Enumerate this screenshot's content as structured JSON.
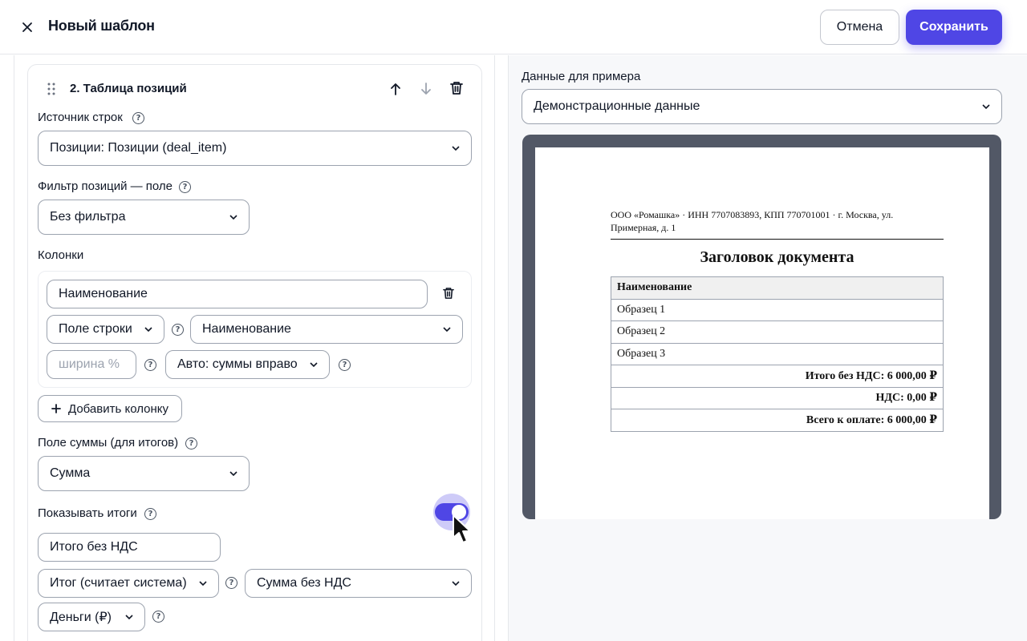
{
  "header": {
    "title": "Новый шаблон",
    "cancel_label": "Отмена",
    "save_label": "Сохранить"
  },
  "section": {
    "title": "2. Таблица позиций",
    "row_source": {
      "label": "Источник строк",
      "value": "Позиции: Позиции (deal_item)"
    },
    "filter": {
      "label": "Фильтр позиций — поле",
      "value": "Без фильтра"
    },
    "columns": {
      "label": "Колонки",
      "items": [
        {
          "name": "Наименование",
          "type": "Поле строки",
          "field": "Наименование",
          "width_placeholder": "ширина %",
          "align": "Авто: суммы вправо"
        }
      ],
      "add_label": "Добавить колонку"
    },
    "sum_field": {
      "label": "Поле суммы (для итогов)",
      "value": "Сумма"
    },
    "show_totals": {
      "label": "Показывать итоги",
      "enabled": true
    },
    "total_row": {
      "name": "Итого без НДС",
      "kind": "Итог (считает система)",
      "source": "Сумма без НДС",
      "format": "Деньги (₽)"
    }
  },
  "preview": {
    "data_label": "Данные для примера",
    "data_value": "Демонстрационные данные",
    "document": {
      "company_line": "ООО «Ромашка» · ИНН 7707083893, КПП 770701001 · г. Москва, ул. Примерная, д. 1",
      "title": "Заголовок документа",
      "column_header": "Наименование",
      "rows": [
        "Образец 1",
        "Образец 2",
        "Образец 3"
      ],
      "totals": [
        "Итого без НДС: 6 000,00 ₽",
        "НДС: 0,00 ₽",
        "Всего к оплате: 6 000,00 ₽"
      ]
    }
  },
  "colors": {
    "accent": "#4f46e5",
    "border": "#9ca3af",
    "preview_bg": "#525866"
  }
}
